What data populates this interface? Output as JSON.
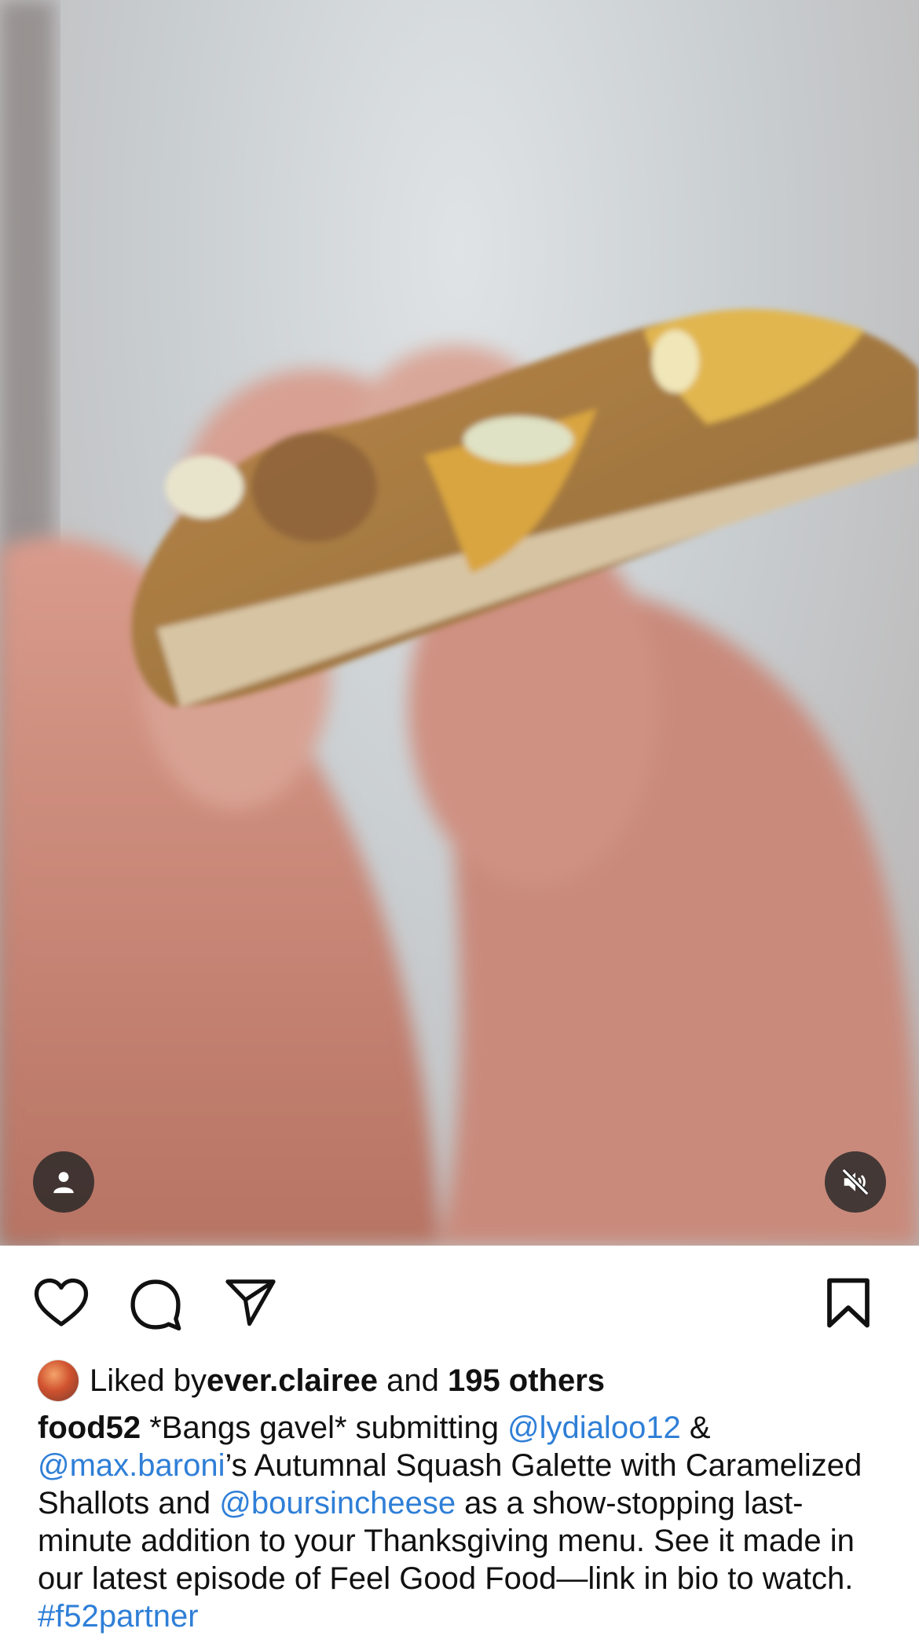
{
  "post": {
    "liked_by_prefix": "Liked by ",
    "liked_by_user": "ever.clairee",
    "and_text": " and ",
    "others": "195 others",
    "caption": {
      "username": "food52",
      "text1": " *Bangs gavel* submitting ",
      "mention1": "@lydialoo12",
      "text2": " & ",
      "mention2": "@max.baroni",
      "text3": "’s Autumnal Squash Galette with Caramelized Shallots and ",
      "mention3": "@boursincheese",
      "text4": " as a show-stopping last-minute addition to your Thanksgiving menu. See it made in our latest episode of Feel Good Food—link in bio to watch. ",
      "hashtag": "#f52partner"
    }
  },
  "icons": {
    "user_tag": "person-icon",
    "mute": "speaker-muted-icon",
    "like": "heart-icon",
    "comment": "comment-bubble-icon",
    "share": "paper-plane-icon",
    "save": "bookmark-icon"
  },
  "colors": {
    "link": "#2f7fd7",
    "overlay_button": "#262626"
  }
}
